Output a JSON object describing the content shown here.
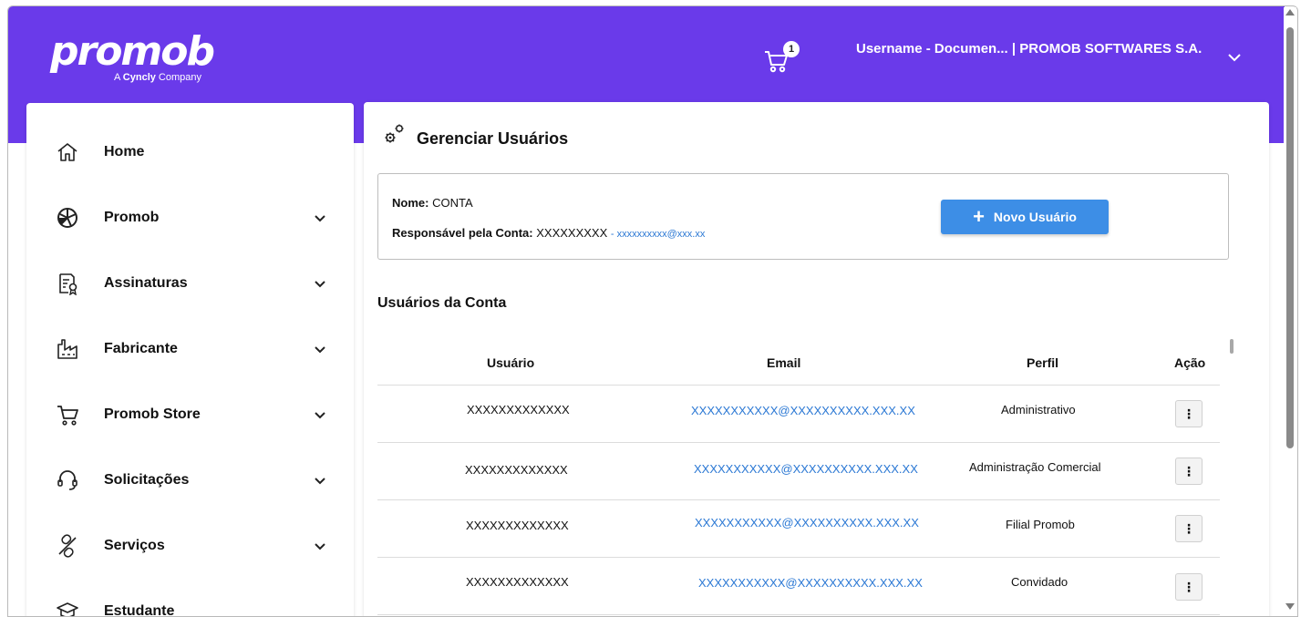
{
  "brand": {
    "logo_text": "promob",
    "tagline_prefix": "A ",
    "tagline_brand": "Cyncly",
    "tagline_suffix": " Company",
    "header_color": "#6a3aea"
  },
  "header": {
    "cart_count": "1",
    "user_label": "Username - Documen... | PROMOB SOFTWARES S.A."
  },
  "sidebar": {
    "items": [
      {
        "label": "Home",
        "icon": "home-icon",
        "has_chevron": false
      },
      {
        "label": "Promob",
        "icon": "promob-icon",
        "has_chevron": true
      },
      {
        "label": "Assinaturas",
        "icon": "certificate-icon",
        "has_chevron": true
      },
      {
        "label": "Fabricante",
        "icon": "factory-icon",
        "has_chevron": true
      },
      {
        "label": "Promob Store",
        "icon": "cart-icon",
        "has_chevron": true
      },
      {
        "label": "Solicitações",
        "icon": "headset-icon",
        "has_chevron": true
      },
      {
        "label": "Serviços",
        "icon": "tools-icon",
        "has_chevron": true
      },
      {
        "label": "Estudante",
        "icon": "graduation-cap-icon",
        "has_chevron": false
      }
    ]
  },
  "main": {
    "title": "Gerenciar Usuários",
    "account": {
      "name_label": "Nome:",
      "name_value": "CONTA",
      "responsible_label": "Responsável pela Conta:",
      "responsible_value": "XXXXXXXXX",
      "responsible_email": " - xxxxxxxxxx@xxx.xx",
      "new_user_button": "Novo Usuário"
    },
    "users_section_title": "Usuários da Conta",
    "table": {
      "headers": [
        "Usuário",
        "Email",
        "Perfil",
        "Ação"
      ],
      "rows": [
        {
          "user": "XXXXXXXXXXXXX",
          "email": "XXXXXXXXXXX@XXXXXXXXXX.XXX.XX",
          "profile": "Administrativo",
          "action": "⋮"
        },
        {
          "user": "XXXXXXXXXXXXX",
          "email": "XXXXXXXXXXX@XXXXXXXXXX.XXX.XX",
          "profile": "Administração Comercial",
          "action": "⋮"
        },
        {
          "user": "XXXXXXXXXXXXX",
          "email": "XXXXXXXXXXX@XXXXXXXXXX.XXX.XX",
          "profile": "Filial Promob",
          "action": "⋮"
        },
        {
          "user": "XXXXXXXXXXXXX",
          "email": "XXXXXXXXXXX@XXXXXXXXXX.XXX.XX",
          "profile": "Convidado",
          "action": "⋮"
        }
      ]
    }
  },
  "colors": {
    "accent_blue": "#3d8ee6",
    "link_blue": "#2b78d4"
  }
}
